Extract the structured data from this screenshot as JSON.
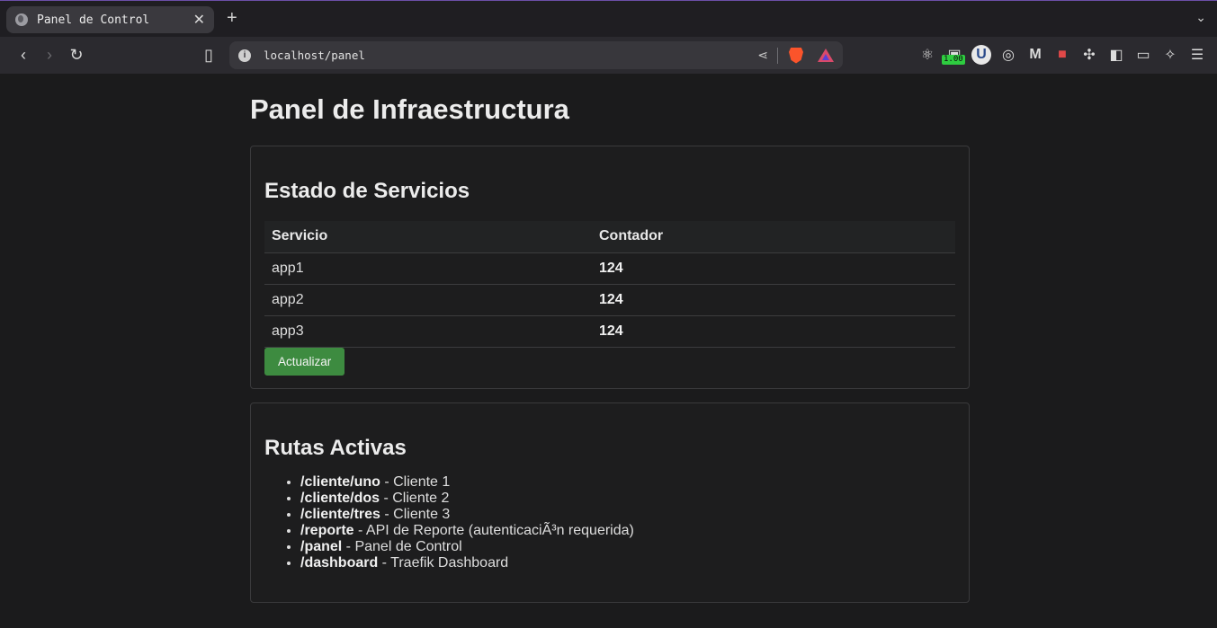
{
  "browser": {
    "tab_title": "Panel de Control",
    "tab_close": "✕",
    "new_tab": "+",
    "url": "localhost/panel",
    "extension_badge": "1.00"
  },
  "page": {
    "title": "Panel de Infraestructura",
    "services_card": {
      "heading": "Estado de Servicios",
      "columns": [
        "Servicio",
        "Contador"
      ],
      "rows": [
        {
          "service": "app1",
          "count": "124"
        },
        {
          "service": "app2",
          "count": "124"
        },
        {
          "service": "app3",
          "count": "124"
        }
      ],
      "refresh_button": "Actualizar"
    },
    "routes_card": {
      "heading": "Rutas Activas",
      "routes": [
        {
          "path": "/cliente/uno",
          "desc": " - Cliente 1"
        },
        {
          "path": "/cliente/dos",
          "desc": " - Cliente 2"
        },
        {
          "path": "/cliente/tres",
          "desc": " - Cliente 3"
        },
        {
          "path": "/reporte",
          "desc": " - API de Reporte (autenticaciÃ³n requerida)"
        },
        {
          "path": "/panel",
          "desc": " - Panel de Control"
        },
        {
          "path": "/dashboard",
          "desc": " - Traefik Dashboard"
        }
      ]
    }
  },
  "colors": {
    "background": "#1b1b1c",
    "button": "#3d8b40",
    "tab_active": "#3a393e"
  }
}
